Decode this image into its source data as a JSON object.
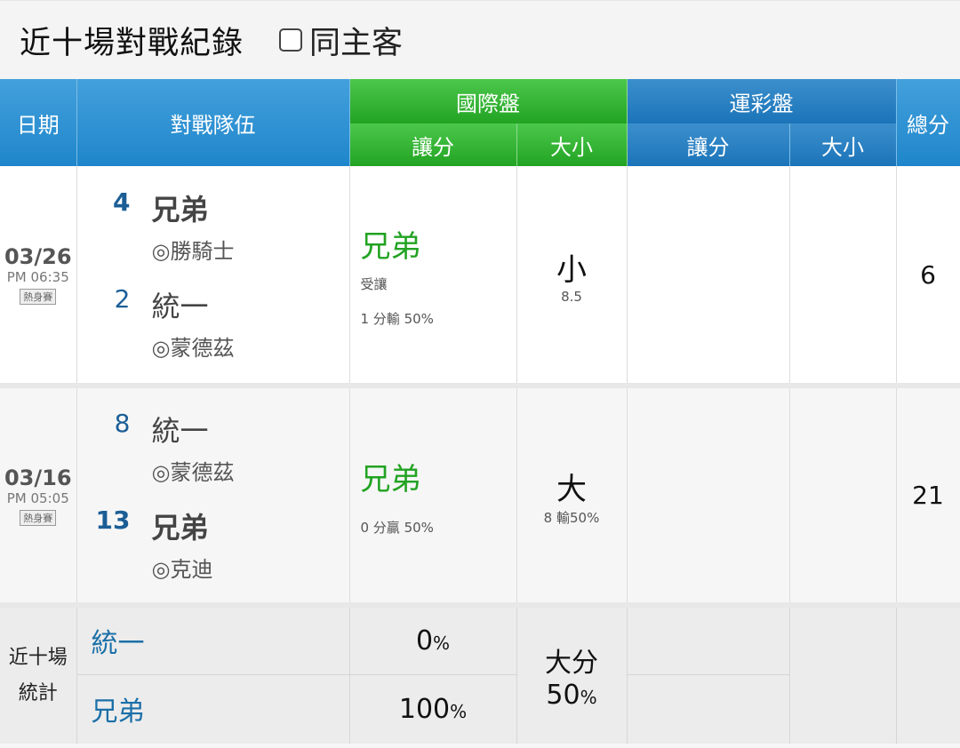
{
  "header": {
    "title": "近十場對戰紀錄",
    "same_host_label": "同主客"
  },
  "table_headers": {
    "date": "日期",
    "teams": "對戰隊伍",
    "intl": "國際盤",
    "lottery": "運彩盤",
    "total": "總分",
    "handicap": "讓分",
    "over_under": "大小"
  },
  "games": [
    {
      "date": "03/26",
      "time": "PM 06:35",
      "type": "熱身賽",
      "team1": {
        "score": "4",
        "name": "兄弟",
        "pitcher": "◎勝騎士"
      },
      "team2": {
        "score": "2",
        "name": "統一",
        "pitcher": "◎蒙德茲"
      },
      "intl_handicap": {
        "team": "兄弟",
        "note": "受讓",
        "line": "1 分輸 50%"
      },
      "intl_ou": {
        "result": "小",
        "line": "8.5"
      },
      "total": "6"
    },
    {
      "date": "03/16",
      "time": "PM 05:05",
      "type": "熱身賽",
      "team1": {
        "score": "8",
        "name": "統一",
        "pitcher": "◎蒙德茲"
      },
      "team2": {
        "score": "13",
        "name": "兄弟",
        "pitcher": "◎克迪"
      },
      "intl_handicap": {
        "team": "兄弟",
        "note": "",
        "line": "0 分贏 50%"
      },
      "intl_ou": {
        "result": "大",
        "line": "8  輸50%"
      },
      "total": "21"
    }
  ],
  "stats": {
    "label_line1": "近十場",
    "label_line2": "統計",
    "team1": "統一",
    "team1_pct": "0",
    "team2": "兄弟",
    "team2_pct": "100",
    "pct_sign": "%",
    "ou_label": "大分",
    "ou_pct": "50"
  },
  "colors": {
    "header_blue": "#1f86cb",
    "header_green": "#22a322",
    "team_green": "#22a322",
    "score_blue": "#1b5e96"
  }
}
